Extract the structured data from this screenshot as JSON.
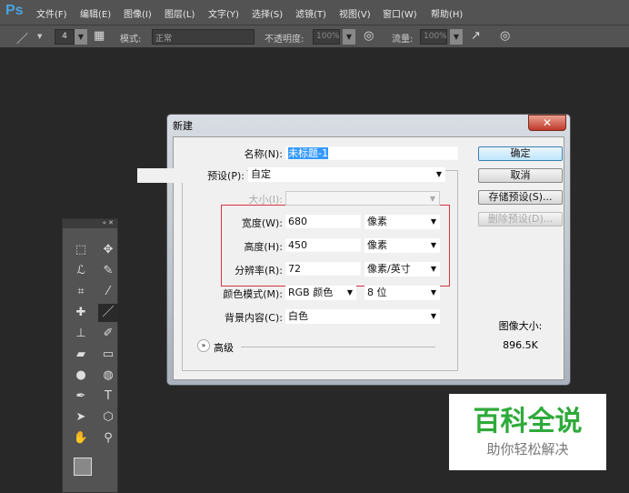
{
  "app": {
    "logo": "Ps"
  },
  "menu": [
    "文件(F)",
    "编辑(E)",
    "图像(I)",
    "图层(L)",
    "文字(Y)",
    "选择(S)",
    "滤镜(T)",
    "视图(V)",
    "窗口(W)",
    "帮助(H)"
  ],
  "options": {
    "brush_size": "4",
    "mode_label": "模式:",
    "mode_value": "正常",
    "opacity_label": "不透明度:",
    "opacity_value": "100%",
    "flow_label": "流量:",
    "flow_value": "100%"
  },
  "dialog": {
    "title": "新建",
    "close": "✕",
    "name_label": "名称(N):",
    "name_value": "未标题-1",
    "preset_label": "预设(P):",
    "preset_value": "自定",
    "size_label": "大小(I):",
    "width_label": "宽度(W):",
    "width_value": "680",
    "width_unit": "像素",
    "height_label": "高度(H):",
    "height_value": "450",
    "height_unit": "像素",
    "res_label": "分辨率(R):",
    "res_value": "72",
    "res_unit": "像素/英寸",
    "color_label": "颜色模式(M):",
    "color_value": "RGB 颜色",
    "bit_value": "8 位",
    "bg_label": "背景内容(C):",
    "bg_value": "白色",
    "advanced": "高级",
    "ok": "确定",
    "cancel": "取消",
    "save_preset": "存储预设(S)...",
    "delete_preset": "删除预设(D)...",
    "image_size_label": "图像大小:",
    "image_size_value": "896.5K",
    "highlight_color": "#d9333f"
  },
  "watermark": {
    "title": "百科全说",
    "subtitle": "助你轻松解决",
    "color": "#2eaa3a"
  }
}
